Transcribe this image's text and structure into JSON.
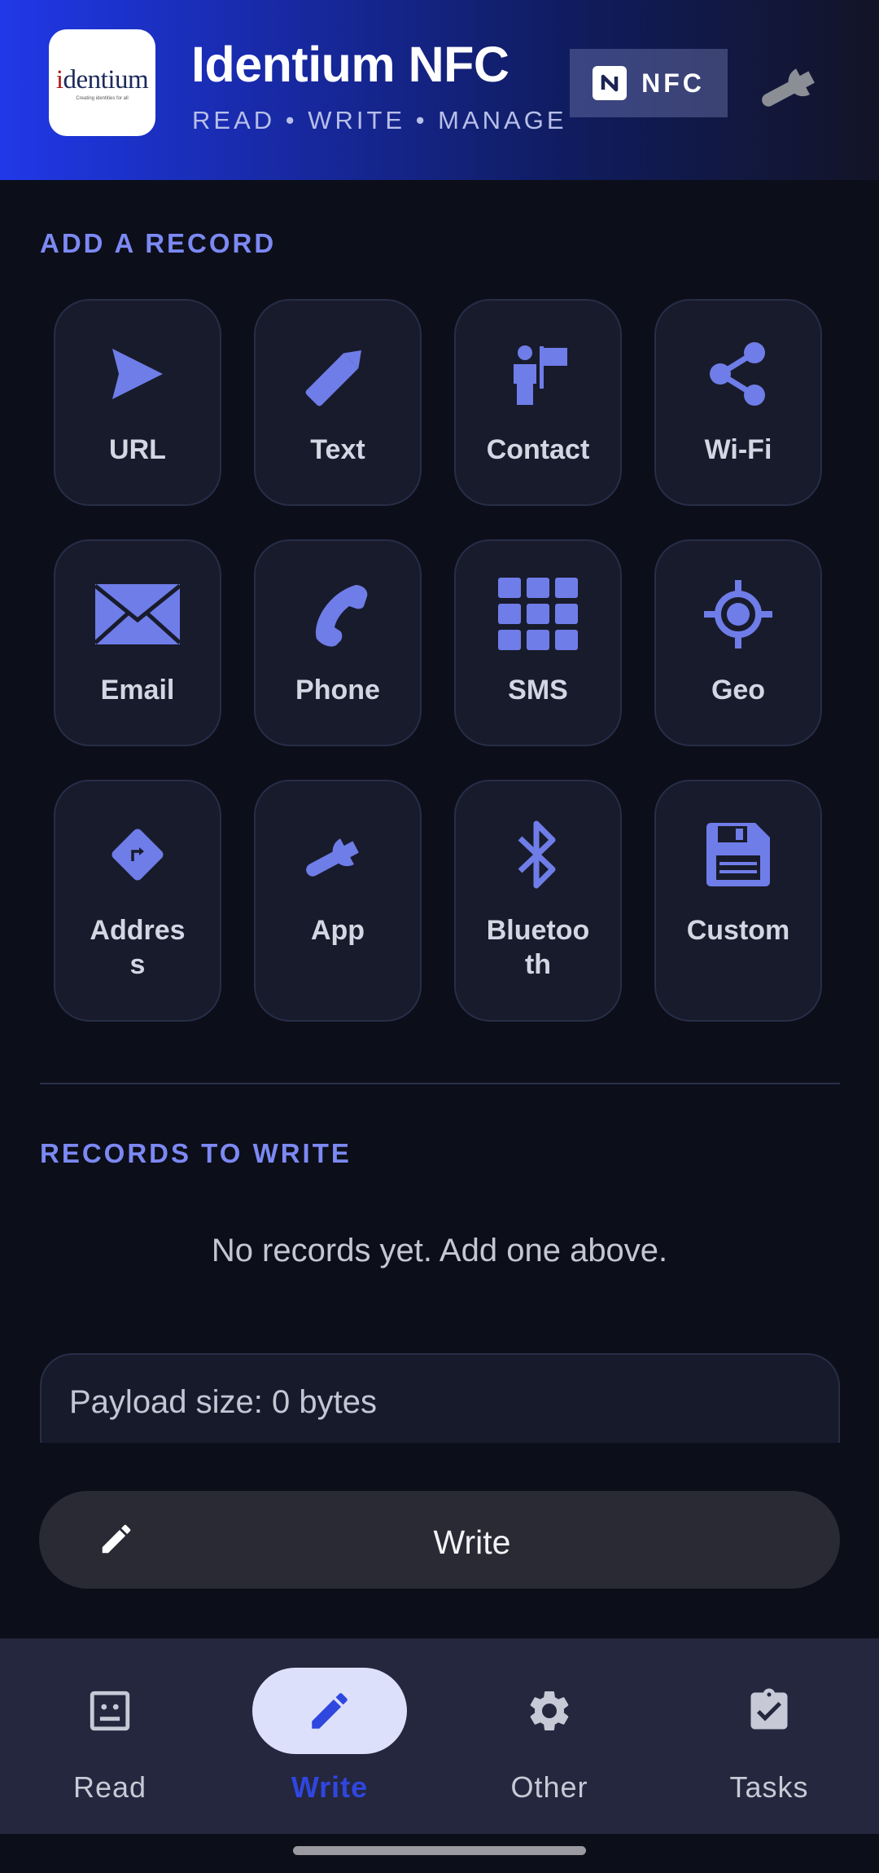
{
  "header": {
    "logo_text": "identium",
    "logo_tagline": "Creating identities for all",
    "title": "Identium NFC",
    "subtitle": "READ • WRITE • MANAGE",
    "nfc_badge": "NFC"
  },
  "add_record": {
    "heading": "ADD A RECORD",
    "tiles": [
      {
        "label": "URL",
        "icon": "send-icon"
      },
      {
        "label": "Text",
        "icon": "pencil-icon"
      },
      {
        "label": "Contact",
        "icon": "contact-icon"
      },
      {
        "label": "Wi-Fi",
        "icon": "share-icon"
      },
      {
        "label": "Email",
        "icon": "envelope-icon"
      },
      {
        "label": "Phone",
        "icon": "phone-icon"
      },
      {
        "label": "SMS",
        "icon": "grid-icon"
      },
      {
        "label": "Geo",
        "icon": "crosshair-icon"
      },
      {
        "label": "Address",
        "icon": "directions-icon"
      },
      {
        "label": "App",
        "icon": "wrench-icon"
      },
      {
        "label": "Bluetooth",
        "icon": "bluetooth-icon"
      },
      {
        "label": "Custom",
        "icon": "floppy-icon"
      }
    ]
  },
  "records": {
    "heading": "RECORDS TO WRITE",
    "empty_message": "No records yet. Add one above.",
    "payload_size": "Payload size: 0 bytes"
  },
  "write_button": {
    "label": "Write"
  },
  "nav": {
    "items": [
      {
        "label": "Read",
        "icon": "read-icon"
      },
      {
        "label": "Write",
        "icon": "pencil-icon"
      },
      {
        "label": "Other",
        "icon": "gear-icon"
      },
      {
        "label": "Tasks",
        "icon": "clipboard-check-icon"
      }
    ],
    "active": "Write"
  },
  "colors": {
    "accent": "#7c89f3",
    "icon": "#6f7de8",
    "background": "#0c0e19",
    "active_nav": "#3046e0"
  }
}
